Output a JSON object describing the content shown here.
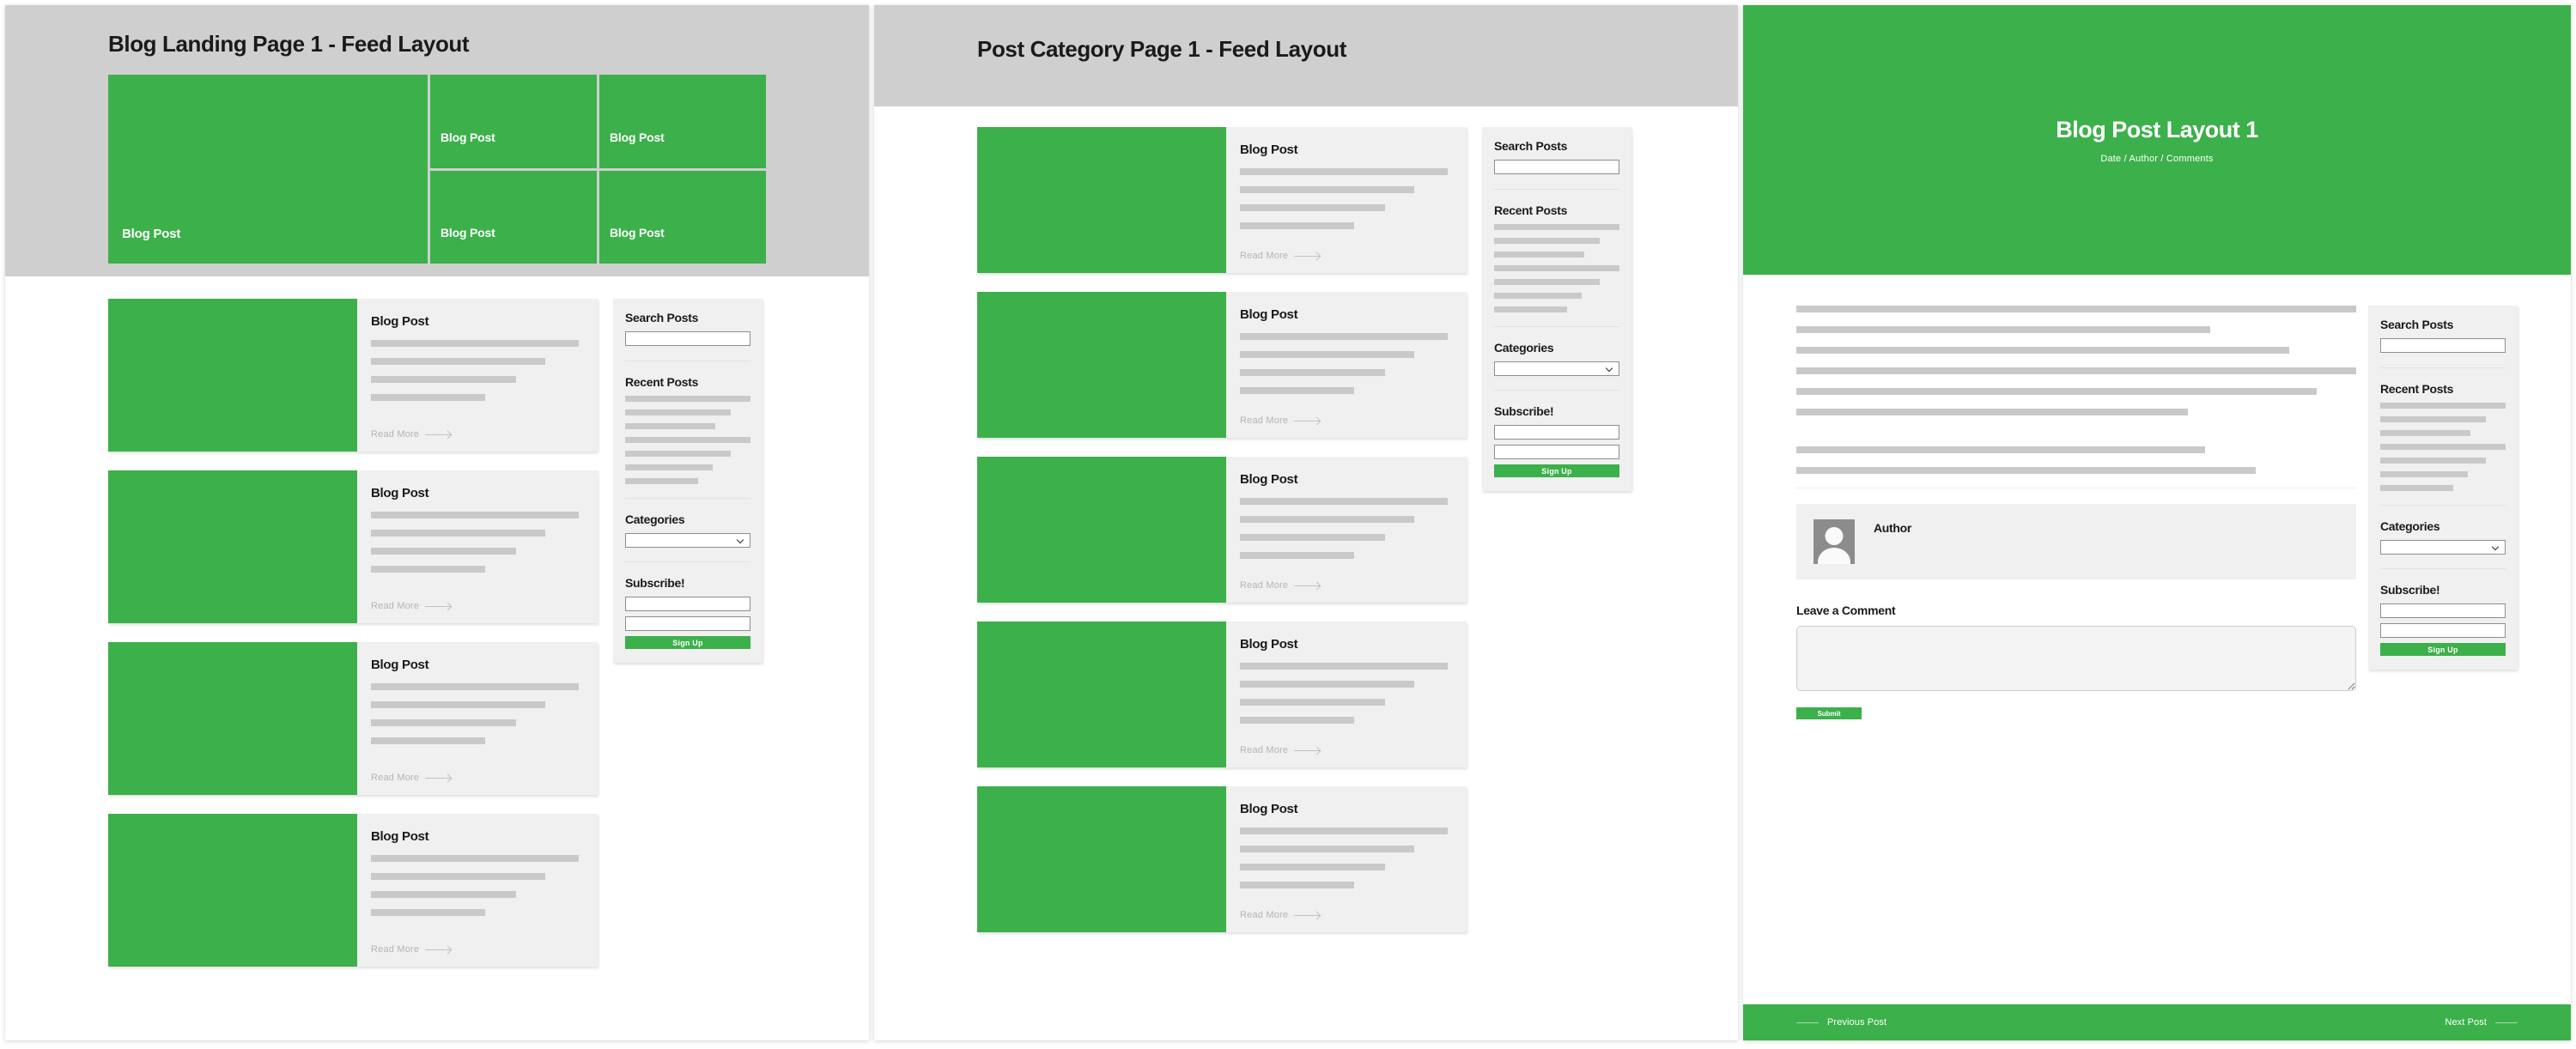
{
  "panels": {
    "landing": {
      "title": "Blog Landing Page 1 - Feed Layout",
      "hero_tiles": [
        {
          "label": "Blog Post"
        },
        {
          "label": "Blog Post"
        },
        {
          "label": "Blog Post"
        },
        {
          "label": "Blog Post"
        },
        {
          "label": "Blog Post"
        }
      ],
      "posts": [
        {
          "heading": "Blog Post",
          "read_more": "Read More"
        },
        {
          "heading": "Blog Post",
          "read_more": "Read More"
        },
        {
          "heading": "Blog Post",
          "read_more": "Read More"
        },
        {
          "heading": "Blog Post",
          "read_more": "Read More"
        }
      ]
    },
    "category": {
      "title": "Post Category Page 1 - Feed Layout",
      "posts": [
        {
          "heading": "Blog Post",
          "read_more": "Read More"
        },
        {
          "heading": "Blog Post",
          "read_more": "Read More"
        },
        {
          "heading": "Blog Post",
          "read_more": "Read More"
        },
        {
          "heading": "Blog Post",
          "read_more": "Read More"
        },
        {
          "heading": "Blog Post",
          "read_more": "Read More"
        }
      ]
    },
    "post": {
      "title": "Blog Post Layout 1",
      "meta": "Date / Author / Comments",
      "author_name": "Author",
      "comment_heading": "Leave a Comment",
      "submit_label": "Submit",
      "prev_label": "Previous Post",
      "next_label": "Next Post"
    }
  },
  "sidebar": {
    "search_title": "Search Posts",
    "search_value": "",
    "recent_title": "Recent Posts",
    "recent_line_widths": [
      "100%",
      "84%",
      "72%",
      "100%",
      "84%",
      "70%",
      "58%"
    ],
    "categories_title": "Categories",
    "categories_selected": "",
    "subscribe_title": "Subscribe!",
    "subscribe_field_1": "",
    "subscribe_field_2": "",
    "signup_label": "Sign Up"
  },
  "post_card_line_widths": [
    "100%",
    "84%",
    "70%",
    "55%"
  ],
  "article_lines_group_1": [
    "100%",
    "74%",
    "88%",
    "100%",
    "93%",
    "70%"
  ],
  "article_lines_group_2": [
    "73%",
    "82%"
  ],
  "colors": {
    "brand_green": "#3cb04a",
    "hero_band_gray": "#cfcfcf",
    "card_gray": "#f0f0f0",
    "placeholder_gray": "#c9c9c9",
    "avatar_gray": "#8c8c8c",
    "text_dark": "#1a1a1a",
    "muted_text": "#b4b4b4"
  }
}
